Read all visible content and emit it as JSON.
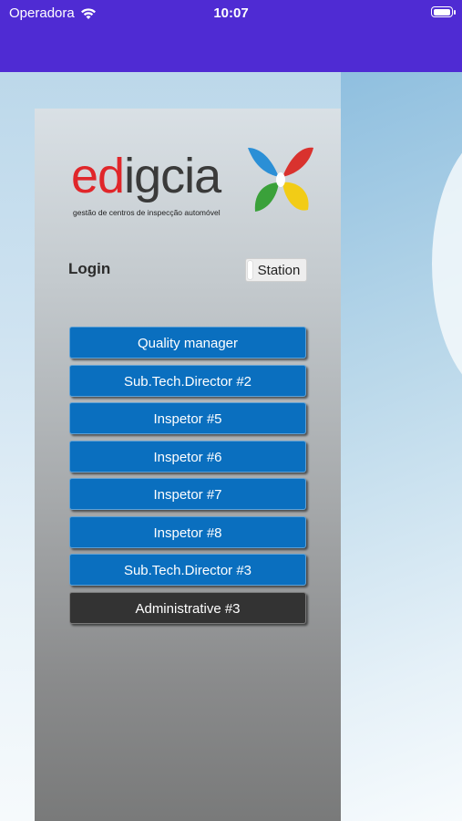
{
  "status_bar": {
    "carrier": "Operadora",
    "time": "10:07"
  },
  "logo": {
    "word": "edigcia",
    "tagline": "gestão de centros de inspecção automóvel"
  },
  "login": {
    "title": "Login",
    "station_label": "Station",
    "users": [
      {
        "label": "Quality manager",
        "color": "#0a6fbf"
      },
      {
        "label": "Sub.Tech.Director #2",
        "color": "#0a6fbf"
      },
      {
        "label": "Inspetor #5",
        "color": "#0a6fbf"
      },
      {
        "label": "Inspetor #6",
        "color": "#0a6fbf"
      },
      {
        "label": "Inspetor #7",
        "color": "#0a6fbf"
      },
      {
        "label": "Inspetor #8",
        "color": "#0a6fbf"
      },
      {
        "label": "Sub.Tech.Director #3",
        "color": "#0a6fbf"
      },
      {
        "label": "Administrative #3",
        "color": "#333333"
      }
    ]
  },
  "colors": {
    "status_bar": "#4f2bd3",
    "button_blue": "#0a6fbf",
    "button_dark": "#333333",
    "logo_red": "#e0262a",
    "logo_dark": "#3a3a3a"
  },
  "icons": [
    "wifi-icon",
    "battery-icon",
    "logo-butterfly-icon"
  ]
}
